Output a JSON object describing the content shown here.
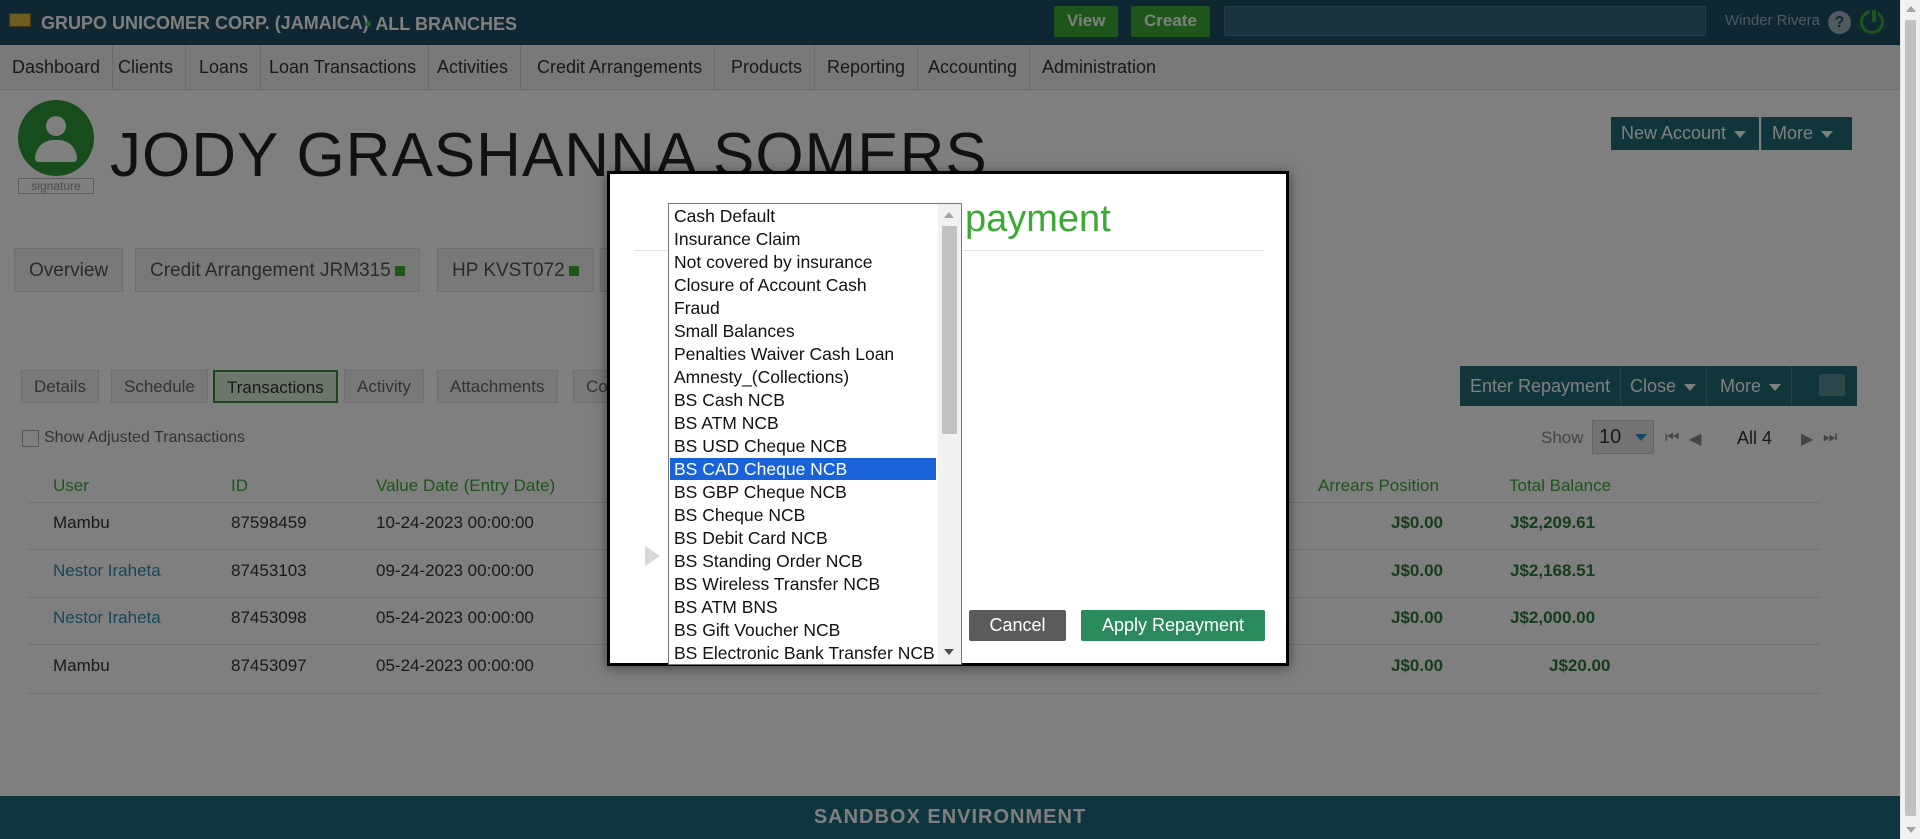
{
  "topbar": {
    "org_name": "GRUPO UNICOMER CORP. (JAMAICA)",
    "branch": "ALL BRANCHES",
    "view_label": "View",
    "create_label": "Create",
    "user_name": "Winder Rivera",
    "help_glyph": "?"
  },
  "nav": {
    "items": [
      "Dashboard",
      "Clients",
      "Loans",
      "Loan Transactions",
      "Activities",
      "Credit Arrangements",
      "Products",
      "Reporting",
      "Accounting",
      "Administration"
    ]
  },
  "client": {
    "name": "JODY GRASHANNA SOMERS",
    "signature_label": "signature",
    "new_account_label": "New Account",
    "more_label": "More"
  },
  "account_tabs": [
    {
      "label": "Overview"
    },
    {
      "label": "Credit Arrangement JRM315"
    },
    {
      "label": "HP KVST072"
    }
  ],
  "subtabs": [
    "Details",
    "Schedule",
    "Transactions",
    "Activity",
    "Attachments",
    "Co"
  ],
  "actions": {
    "enter_repayment": "Enter Repayment",
    "close": "Close",
    "more": "More"
  },
  "filters": {
    "show_adjusted": "Show Adjusted Transactions",
    "show_label": "Show",
    "show_value": "10",
    "page_label": "All 4"
  },
  "table": {
    "headers": [
      "User",
      "ID",
      "Value Date (Entry Date)",
      "Arrears Position",
      "Total Balance"
    ],
    "rows": [
      {
        "user": "Mambu",
        "id": "87598459",
        "date": "10-24-2023 00:00:00",
        "arrears": "J$0.00",
        "total": "J$2,209.61"
      },
      {
        "user": "Nestor Iraheta",
        "id": "87453103",
        "date": "09-24-2023 00:00:00",
        "arrears": "J$0.00",
        "total": "J$2,168.51"
      },
      {
        "user": "Nestor Iraheta",
        "id": "87453098",
        "date": "05-24-2023 00:00:00",
        "arrears": "J$0.00",
        "total": "J$2,000.00"
      },
      {
        "user": "Mambu",
        "id": "87453097",
        "date": "05-24-2023 00:00:00",
        "arrears": "J$0.00",
        "total": "J$20.00"
      }
    ]
  },
  "footer": {
    "sandbox": "SANDBOX ENVIRONMENT"
  },
  "modal": {
    "title_visible": "payment",
    "cancel_label": "Cancel",
    "apply_label": "Apply Repayment"
  },
  "dropdown": {
    "selected": "BS CAD Cheque NCB",
    "options": [
      "Cash Default",
      "Insurance Claim",
      "Not covered by insurance",
      "Closure of Account Cash",
      "Fraud",
      "Small Balances",
      "Penalties Waiver Cash Loan",
      "Amnesty_(Collections)",
      "BS Cash NCB",
      "BS ATM NCB",
      "BS USD Cheque NCB",
      "BS CAD Cheque NCB",
      "BS GBP Cheque NCB",
      "BS Cheque NCB",
      "BS Debit Card NCB",
      "BS Standing Order NCB",
      "BS Wireless Transfer NCB",
      "BS ATM BNS",
      "BS Gift Voucher NCB",
      "BS Electronic Bank Transfer NCB"
    ]
  },
  "colors": {
    "brand_dark": "#1d4e64",
    "accent_green": "#3aaa35",
    "action_teal": "#216a75",
    "selection_blue": "#1a62d8"
  }
}
